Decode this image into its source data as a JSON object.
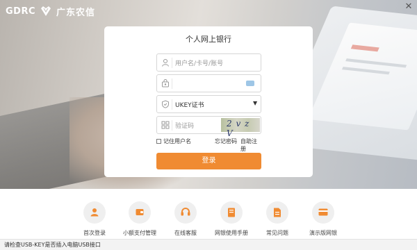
{
  "logo": {
    "text": "GDRC",
    "cn": "广东农信",
    "icon": "diamond-logo-icon"
  },
  "window": {
    "close_label": "✕",
    "close_icon": "close-icon"
  },
  "login": {
    "title": "个人网上银行",
    "username_placeholder": "用户名/卡号/账号",
    "password_placeholder": "",
    "cert_value": "UKEY证书",
    "captcha_placeholder": "验证码",
    "captcha_text": "2 v z V",
    "remember_label": "记住用户名",
    "forgot_label": "忘记密码",
    "register_label": "自助注册",
    "login_button": "登录"
  },
  "quick_links": [
    {
      "label": "首次登录",
      "icon": "user-icon"
    },
    {
      "label": "小额支付管理",
      "icon": "wallet-icon"
    },
    {
      "label": "在线客服",
      "icon": "headset-icon"
    },
    {
      "label": "网银使用手册",
      "icon": "book-icon"
    },
    {
      "label": "常见问题",
      "icon": "document-icon"
    },
    {
      "label": "演示版网银",
      "icon": "card-icon"
    }
  ],
  "status_bar": {
    "text": "请检查USB-KEY是否插入电脑USB接口"
  },
  "colors": {
    "accent": "#f08b32",
    "card_bg": "#ffffff"
  }
}
